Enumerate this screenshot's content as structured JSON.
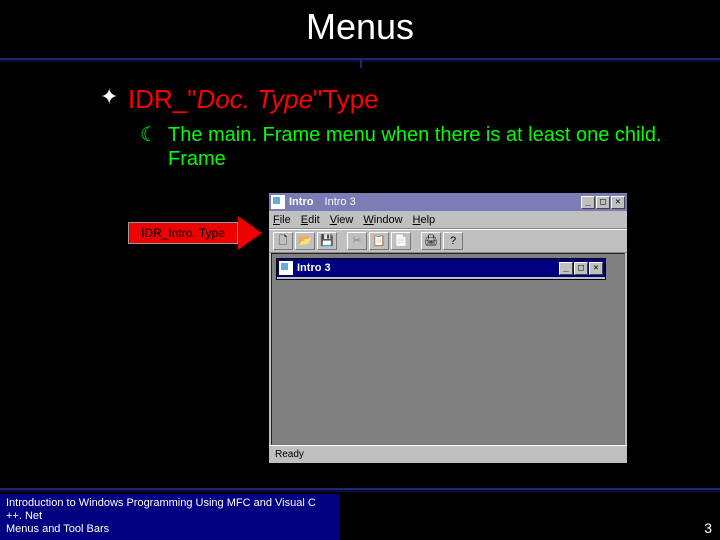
{
  "title": "Menus",
  "bullet1_prefix": "IDR_\"",
  "bullet1_italic": "Doc. Type",
  "bullet1_suffix": "\"Type",
  "sub_text": "The main. Frame menu when there is at least one child. Frame",
  "arrow_label": "IDR_Intro. Type",
  "app": {
    "title_main": "Intro",
    "title_doc": "Intro 3",
    "menus": [
      "File",
      "Edit",
      "View",
      "Window",
      "Help"
    ],
    "tool_icons": [
      "🗋",
      "📂",
      "💾",
      "✂",
      "📋",
      "📄",
      "🖨",
      "?"
    ],
    "child_title": "Intro 3",
    "status": "Ready"
  },
  "footer_line1": "Introduction to Windows Programming Using MFC and Visual C ++. Net",
  "footer_line2": "Menus and Tool Bars",
  "page_number": "3"
}
